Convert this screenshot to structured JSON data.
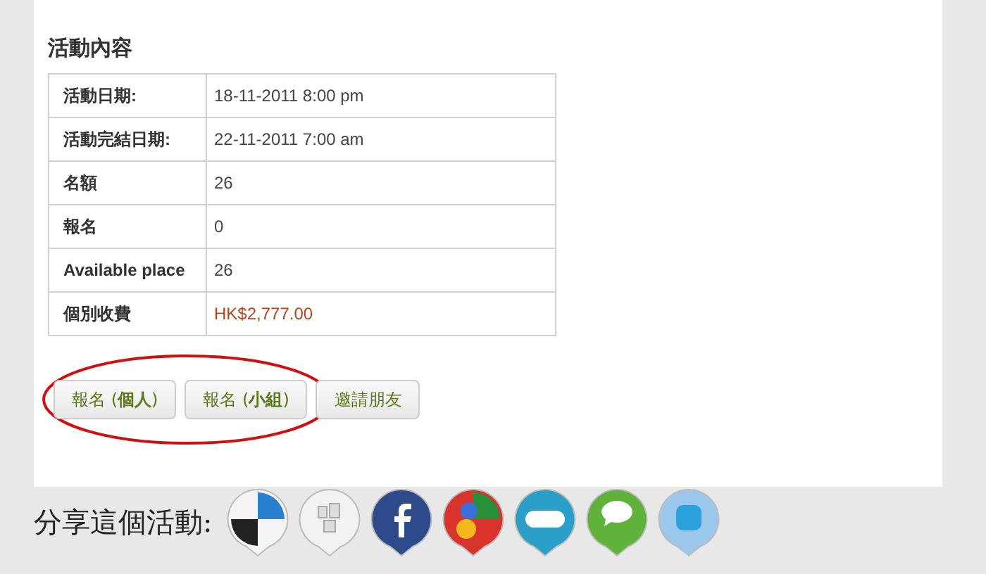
{
  "section_title": "活動內容",
  "rows": [
    {
      "label": "活動日期:",
      "value": "18-11-2011 8:00 pm",
      "kind": "plain"
    },
    {
      "label": "活動完結日期:",
      "value": "22-11-2011 7:00 am",
      "kind": "plain"
    },
    {
      "label": "名額",
      "value": "26",
      "kind": "plain"
    },
    {
      "label": "報名",
      "value": "0",
      "kind": "plain"
    },
    {
      "label": "Available place",
      "value": "26",
      "kind": "plain"
    },
    {
      "label": "個別收費",
      "value": "HK$2,777.00",
      "kind": "price"
    }
  ],
  "buttons": [
    "報名 (**個人**)",
    "報名 (**小組**)",
    "邀請朋友"
  ],
  "share": {
    "label": "分享這個活動:",
    "icons": [
      {
        "kind": "quad"
      },
      {
        "kind": "blocks"
      },
      {
        "kind": "f"
      },
      {
        "kind": "g"
      },
      {
        "kind": "su"
      },
      {
        "kind": "chat"
      },
      {
        "kind": "bird"
      }
    ]
  }
}
